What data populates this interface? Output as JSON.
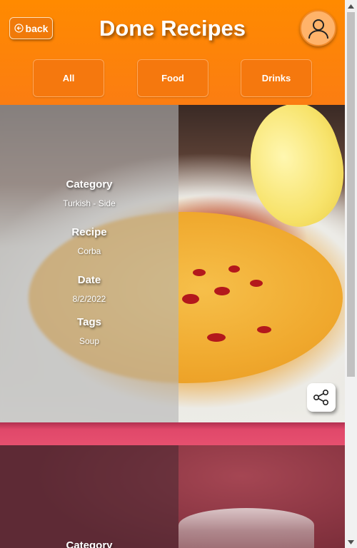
{
  "header": {
    "back_label": "back",
    "title": "Done Recipes"
  },
  "filters": [
    {
      "label": "All"
    },
    {
      "label": "Food"
    },
    {
      "label": "Drinks"
    }
  ],
  "cards": [
    {
      "category_label": "Category",
      "category_value": "Turkish - Side",
      "recipe_label": "Recipe",
      "recipe_value": "Corba",
      "date_label": "Date",
      "date_value": "8/2/2022",
      "tags_label": "Tags",
      "tags_value": "Soup",
      "share_icon": "share-icon"
    },
    {
      "category_label": "Category"
    }
  ],
  "colors": {
    "header_orange": "#ff8a00",
    "divider_pink": "#e0486a",
    "accent_white": "#ffffff"
  }
}
